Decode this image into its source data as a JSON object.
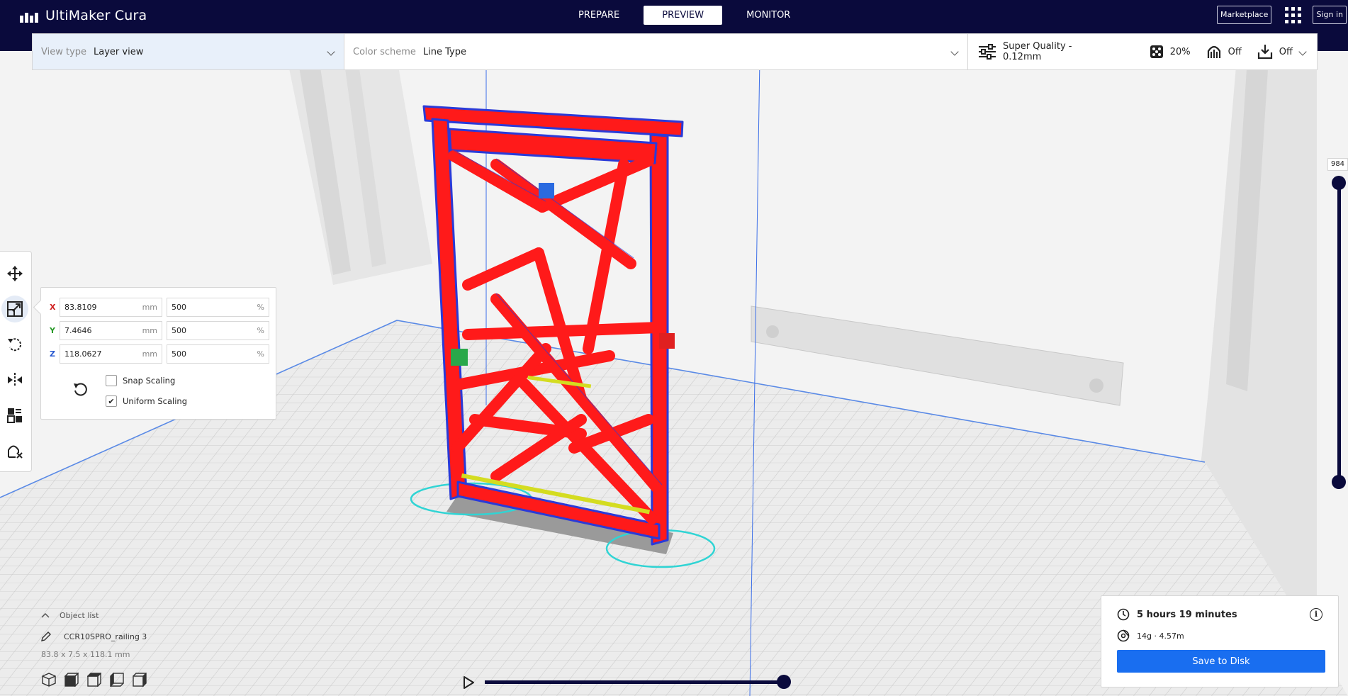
{
  "app": {
    "title": "UltiMaker Cura"
  },
  "nav": {
    "tabs": [
      {
        "label": "PREPARE",
        "active": false
      },
      {
        "label": "PREVIEW",
        "active": true
      },
      {
        "label": "MONITOR",
        "active": false
      }
    ]
  },
  "header": {
    "marketplace_label": "Marketplace",
    "signin_label": "Sign in",
    "apps_icon": "apps-grid-icon"
  },
  "stage": {
    "view_type_label": "View type",
    "view_type_value": "Layer view",
    "color_scheme_label": "Color scheme",
    "color_scheme_value": "Line Type",
    "profile": "Super Quality - 0.12mm",
    "infill": "20%",
    "support": "Off",
    "adhesion": "Off"
  },
  "tools": [
    {
      "name": "move-tool",
      "icon": "move-icon"
    },
    {
      "name": "scale-tool",
      "icon": "scale-icon",
      "active": true
    },
    {
      "name": "rotate-tool",
      "icon": "rotate-icon"
    },
    {
      "name": "mirror-tool",
      "icon": "mirror-icon"
    },
    {
      "name": "per-model-settings-tool",
      "icon": "per-model-settings-icon"
    },
    {
      "name": "support-blocker-tool",
      "icon": "support-blocker-icon"
    }
  ],
  "scale": {
    "x_label": "X",
    "y_label": "Y",
    "z_label": "Z",
    "x_mm": "83.8109",
    "y_mm": "7.4646",
    "z_mm": "118.0627",
    "x_pct": "500",
    "y_pct": "500",
    "z_pct": "500",
    "mm_unit": "mm",
    "pct_unit": "%",
    "snap_scaling_label": "Snap Scaling",
    "snap_scaling_checked": false,
    "uniform_scaling_label": "Uniform Scaling",
    "uniform_scaling_checked": true,
    "checkmark": "✔"
  },
  "layer_slider": {
    "current_layer": "984",
    "max_fraction": 1.0,
    "min_fraction": 0.0
  },
  "play_slider": {
    "progress_fraction": 1.0
  },
  "object_list": {
    "header": "Object list",
    "object_name": "CCR10SPRO_railing 3",
    "dimensions": "83.8 x 7.5 x 118.1 mm"
  },
  "print_info": {
    "time": "5 hours 19 minutes",
    "material": "14g · 4.57m",
    "save_label": "Save to Disk",
    "info_glyph": "i"
  },
  "colors": {
    "header": "#0a0a3c",
    "accent": "#196ef0",
    "model_red": "#ff1a1a",
    "outline_blue": "#2a3ad8",
    "skirt_cyan": "#30d4d4"
  }
}
